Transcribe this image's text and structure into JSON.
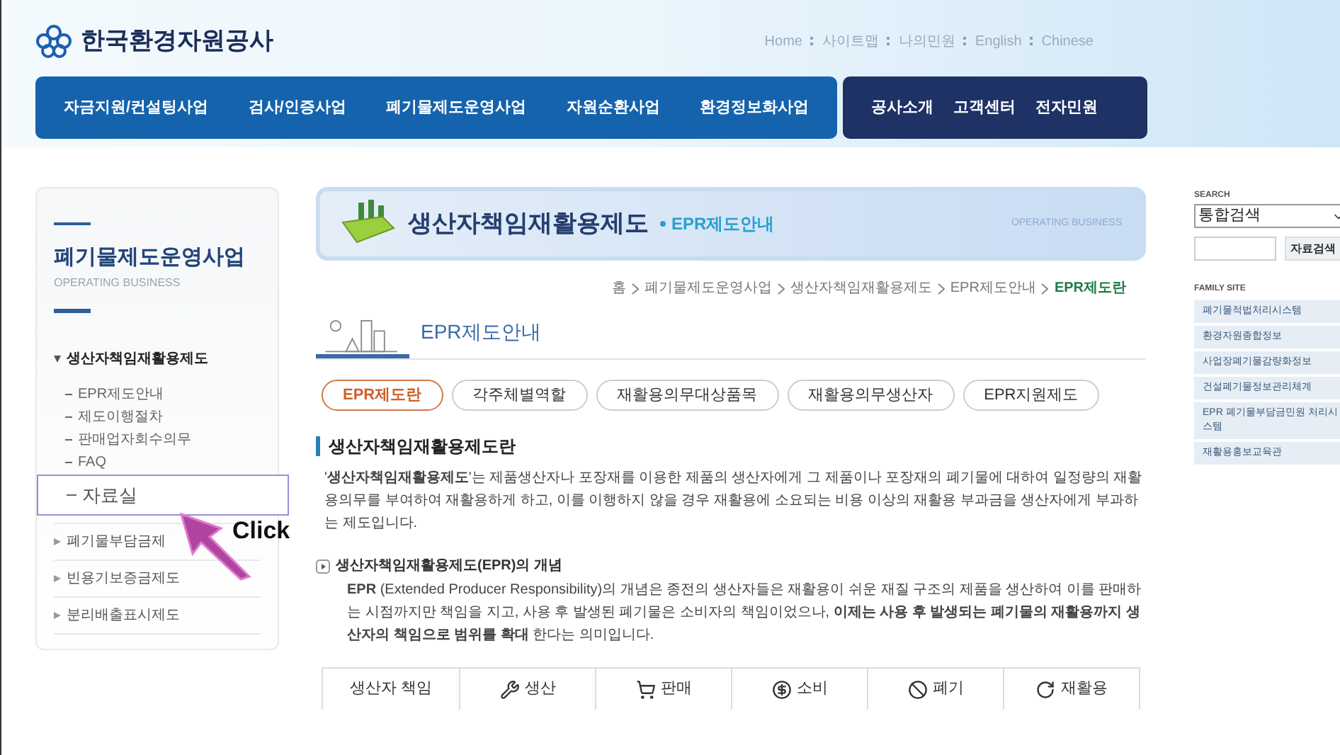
{
  "header": {
    "logo_text": "한국환경자원공사",
    "util_links": [
      "Home",
      "사이트맵",
      "나의민원",
      "English",
      "Chinese"
    ],
    "nav_main": [
      "자금지원/컨설팅사업",
      "검사/인증사업",
      "폐기물제도운영사업",
      "자원순환사업",
      "환경정보화사업"
    ],
    "nav_sub": [
      "공사소개",
      "고객센터",
      "전자민원"
    ]
  },
  "sidebar": {
    "title": "폐기물제도운영사업",
    "subtitle": "OPERATING BUSINESS",
    "sections": [
      {
        "label": "생산자책임재활용제도",
        "expanded": true,
        "children": [
          {
            "label": "EPR제도안내",
            "selected": false
          },
          {
            "label": "제도이행절차",
            "selected": false
          },
          {
            "label": "판매업자회수의무",
            "selected": false
          },
          {
            "label": "FAQ",
            "selected": false
          },
          {
            "label": "자료실",
            "selected": true
          }
        ]
      },
      {
        "label": "폐기물부담금제",
        "expanded": false
      },
      {
        "label": "빈용기보증금제도",
        "expanded": false
      },
      {
        "label": "분리배출표시제도",
        "expanded": false
      }
    ],
    "annotation": "Click"
  },
  "main": {
    "banner": {
      "title": "생산자책임재활용제도",
      "subtitle": "EPR제도안내",
      "english": "OPERATING BUSINESS"
    },
    "breadcrumb": [
      "홈",
      "폐기물제도운영사업",
      "생산자책임재활용제도",
      "EPR제도안내",
      "EPR제도란"
    ],
    "section_title": "EPR제도안내",
    "tabs": [
      {
        "label": "EPR제도란",
        "selected": true
      },
      {
        "label": "각주체별역할",
        "selected": false
      },
      {
        "label": "재활용의무대상품목",
        "selected": false
      },
      {
        "label": "재활용의무생산자",
        "selected": false
      },
      {
        "label": "EPR지원제도",
        "selected": false
      }
    ],
    "heading": "생산자책임재활용제도란",
    "intro": "'**생산자책임재활용제도**'는 제품생산자나 포장재를 이용한 제품의 생산자에게 그 제품이나 포장재의 폐기물에 대하여 일정량의 재활용의무를 부여하여 재활용하게 하고, 이를 이행하지 않을 경우 재활용에 소요되는 비용 이상의 재활용 부과금을 생산자에게 부과하는 제도입니다.",
    "subheading": "생산자책임재활용제도(EPR)의 개념",
    "concept": "**EPR** (Extended Producer Responsibility)의 개념은 종전의 생산자들은 재활용이 쉬운 재질 구조의 제품을 생산하여 이를 판매하는 시점까지만 책임을 지고, 사용 후 발생된 폐기물은 소비자의 책임이었으나, **이제는 사용 후 발생되는 폐기물의 재활용까지 생산자의 책임으로 범위를 확대** 한다는 의미입니다.",
    "table_headers": [
      {
        "label": "생산자 책임",
        "kind": "text"
      },
      {
        "label": "생산",
        "kind": "wrench"
      },
      {
        "label": "판매",
        "kind": "cart"
      },
      {
        "label": "소비",
        "kind": "coin"
      },
      {
        "label": "폐기",
        "kind": "ban"
      },
      {
        "label": "재활용",
        "kind": "recycle"
      }
    ]
  },
  "right": {
    "search_label": "SEARCH",
    "search_select": "통합검색",
    "search_button": "자료검색",
    "family_label": "FAMILY SITE",
    "family_sites": [
      "폐기물적법처리시스템",
      "환경자원종합정보",
      "사업장폐기물감량화정보",
      "건설폐기물정보관리체계",
      "EPR 폐기물부담금민원 처리시스템",
      "재활용홍보교육관"
    ]
  }
}
